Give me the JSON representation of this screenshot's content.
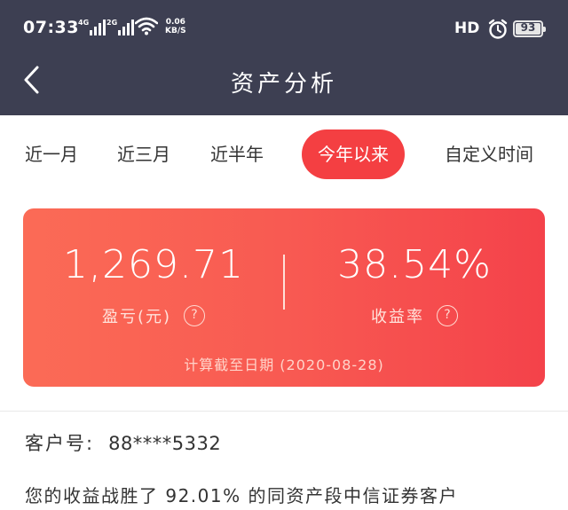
{
  "status_bar": {
    "time": "07:33",
    "net1_label": "4G",
    "net2_label": "2G",
    "net_speed_value": "0.06",
    "net_speed_unit": "KB/S",
    "hd_label": "HD",
    "battery_level": "93"
  },
  "header": {
    "title": "资产分析"
  },
  "tabs": [
    {
      "label": "近一月",
      "active": false
    },
    {
      "label": "近三月",
      "active": false
    },
    {
      "label": "近半年",
      "active": false
    },
    {
      "label": "今年以来",
      "active": true
    },
    {
      "label": "自定义时间",
      "active": false
    }
  ],
  "summary": {
    "profit_value": "1,269.71",
    "profit_label": "盈亏(元)",
    "return_value": "38.54%",
    "return_label": "收益率",
    "help_symbol": "?",
    "calc_date": "计算截至日期 (2020-08-28)"
  },
  "customer": {
    "label": "客户号:",
    "id": "88****5332"
  },
  "beat_text": "您的收益战胜了 92.01% 的同资产段中信证券客户",
  "colors": {
    "header_bg": "#3d3f52",
    "accent": "#f43f42",
    "card_gradient_start": "#fb6b56",
    "card_gradient_end": "#f4424a"
  },
  "icons": [
    "back-icon",
    "wifi-icon",
    "alarm-icon",
    "help-icon"
  ]
}
